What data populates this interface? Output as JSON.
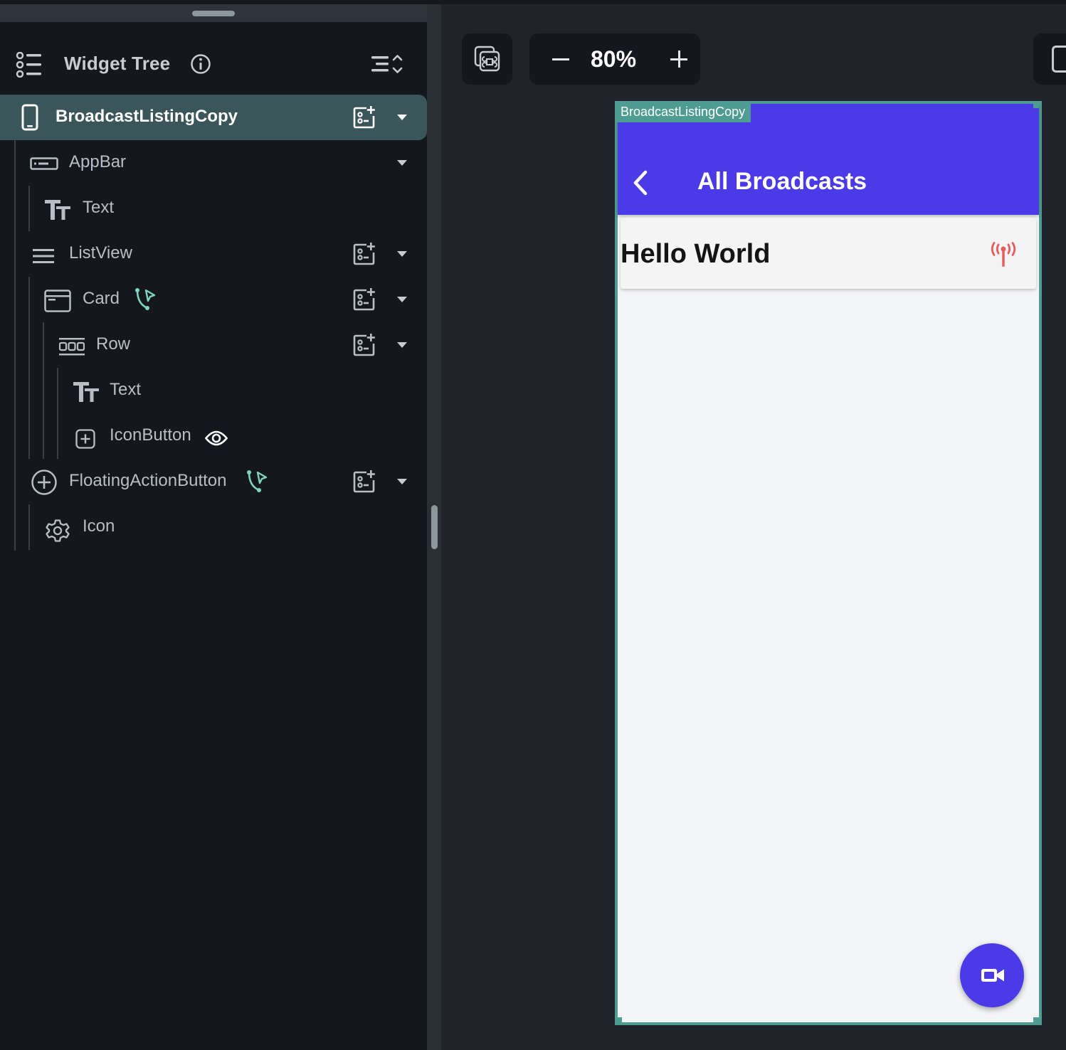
{
  "widget_tree": {
    "title": "Widget Tree",
    "nodes": [
      {
        "label": "BroadcastListingCopy",
        "icon": "phone-icon"
      },
      {
        "label": "AppBar",
        "icon": "appbar-icon"
      },
      {
        "label": "Text",
        "icon": "text-icon"
      },
      {
        "label": "ListView",
        "icon": "listview-icon"
      },
      {
        "label": "Card",
        "icon": "card-icon"
      },
      {
        "label": "Row",
        "icon": "row-icon"
      },
      {
        "label": "Text",
        "icon": "text-icon"
      },
      {
        "label": "IconButton",
        "icon": "icon-button-icon"
      },
      {
        "label": "FloatingActionButton",
        "icon": "fab-icon"
      },
      {
        "label": "Icon",
        "icon": "gear-icon"
      }
    ]
  },
  "toolbar": {
    "zoom_value": "80%"
  },
  "preview": {
    "screen_tag": "BroadcastListingCopy",
    "appbar_title": "All Broadcasts",
    "card_text": "Hello World"
  },
  "colors": {
    "appbar": "#4a3ae8",
    "selection": "#3a565a",
    "accent_teal": "#4e9c92",
    "action_badge": "#7fd3c3",
    "broadcast_icon": "#e65b5b"
  }
}
